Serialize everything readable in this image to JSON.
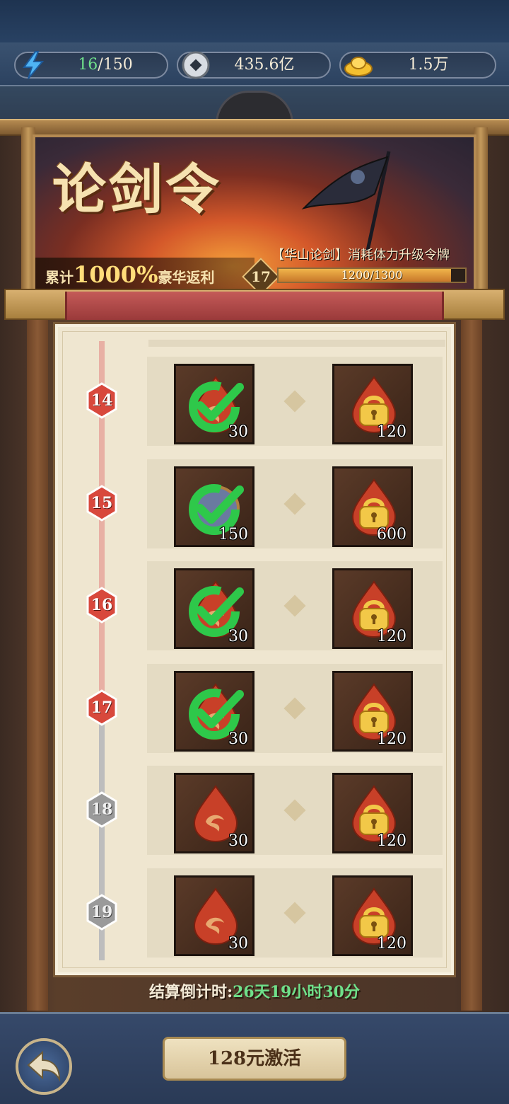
{
  "resources": {
    "energy_current": "16",
    "energy_max": "/150",
    "silver": "435.6亿",
    "gold": "1.5万"
  },
  "banner": {
    "title": "论剑令",
    "promo_prefix": "累计",
    "promo_percent": "1000%",
    "promo_suffix": "豪华返利",
    "description": "【华山论剑】消耗体力升级令牌",
    "level": "17",
    "progress_text": "1200/1300",
    "progress_value": 1200,
    "progress_max": 1300
  },
  "rewards": [
    {
      "level": "14",
      "reached": true,
      "free_qty": "30",
      "free_claimed": true,
      "free_icon": "red-drop-icon",
      "paid_qty": "120",
      "paid_icon": "gold-lock-drop-icon"
    },
    {
      "level": "15",
      "reached": true,
      "free_qty": "150",
      "free_claimed": true,
      "free_icon": "stone-icon",
      "paid_qty": "600",
      "paid_icon": "gold-lock-drop-icon"
    },
    {
      "level": "16",
      "reached": true,
      "free_qty": "30",
      "free_claimed": true,
      "free_icon": "red-drop-icon",
      "paid_qty": "120",
      "paid_icon": "gold-lock-drop-icon"
    },
    {
      "level": "17",
      "reached": true,
      "free_qty": "30",
      "free_claimed": true,
      "free_icon": "red-drop-icon",
      "paid_qty": "120",
      "paid_icon": "gold-lock-drop-icon"
    },
    {
      "level": "18",
      "reached": false,
      "free_qty": "30",
      "free_claimed": false,
      "free_icon": "red-drop-icon",
      "paid_qty": "120",
      "paid_icon": "gold-lock-drop-icon"
    },
    {
      "level": "19",
      "reached": false,
      "free_qty": "30",
      "free_claimed": false,
      "free_icon": "red-drop-icon",
      "paid_qty": "120",
      "paid_icon": "gold-lock-drop-icon"
    }
  ],
  "countdown": {
    "label": "结算倒计时:",
    "time": "26天19小时30分"
  },
  "footer": {
    "activate_label": "128元激活"
  },
  "colors": {
    "accent_green": "#6fe08a",
    "badge_reached": "#d8483c",
    "badge_locked": "#9a9a9a"
  }
}
